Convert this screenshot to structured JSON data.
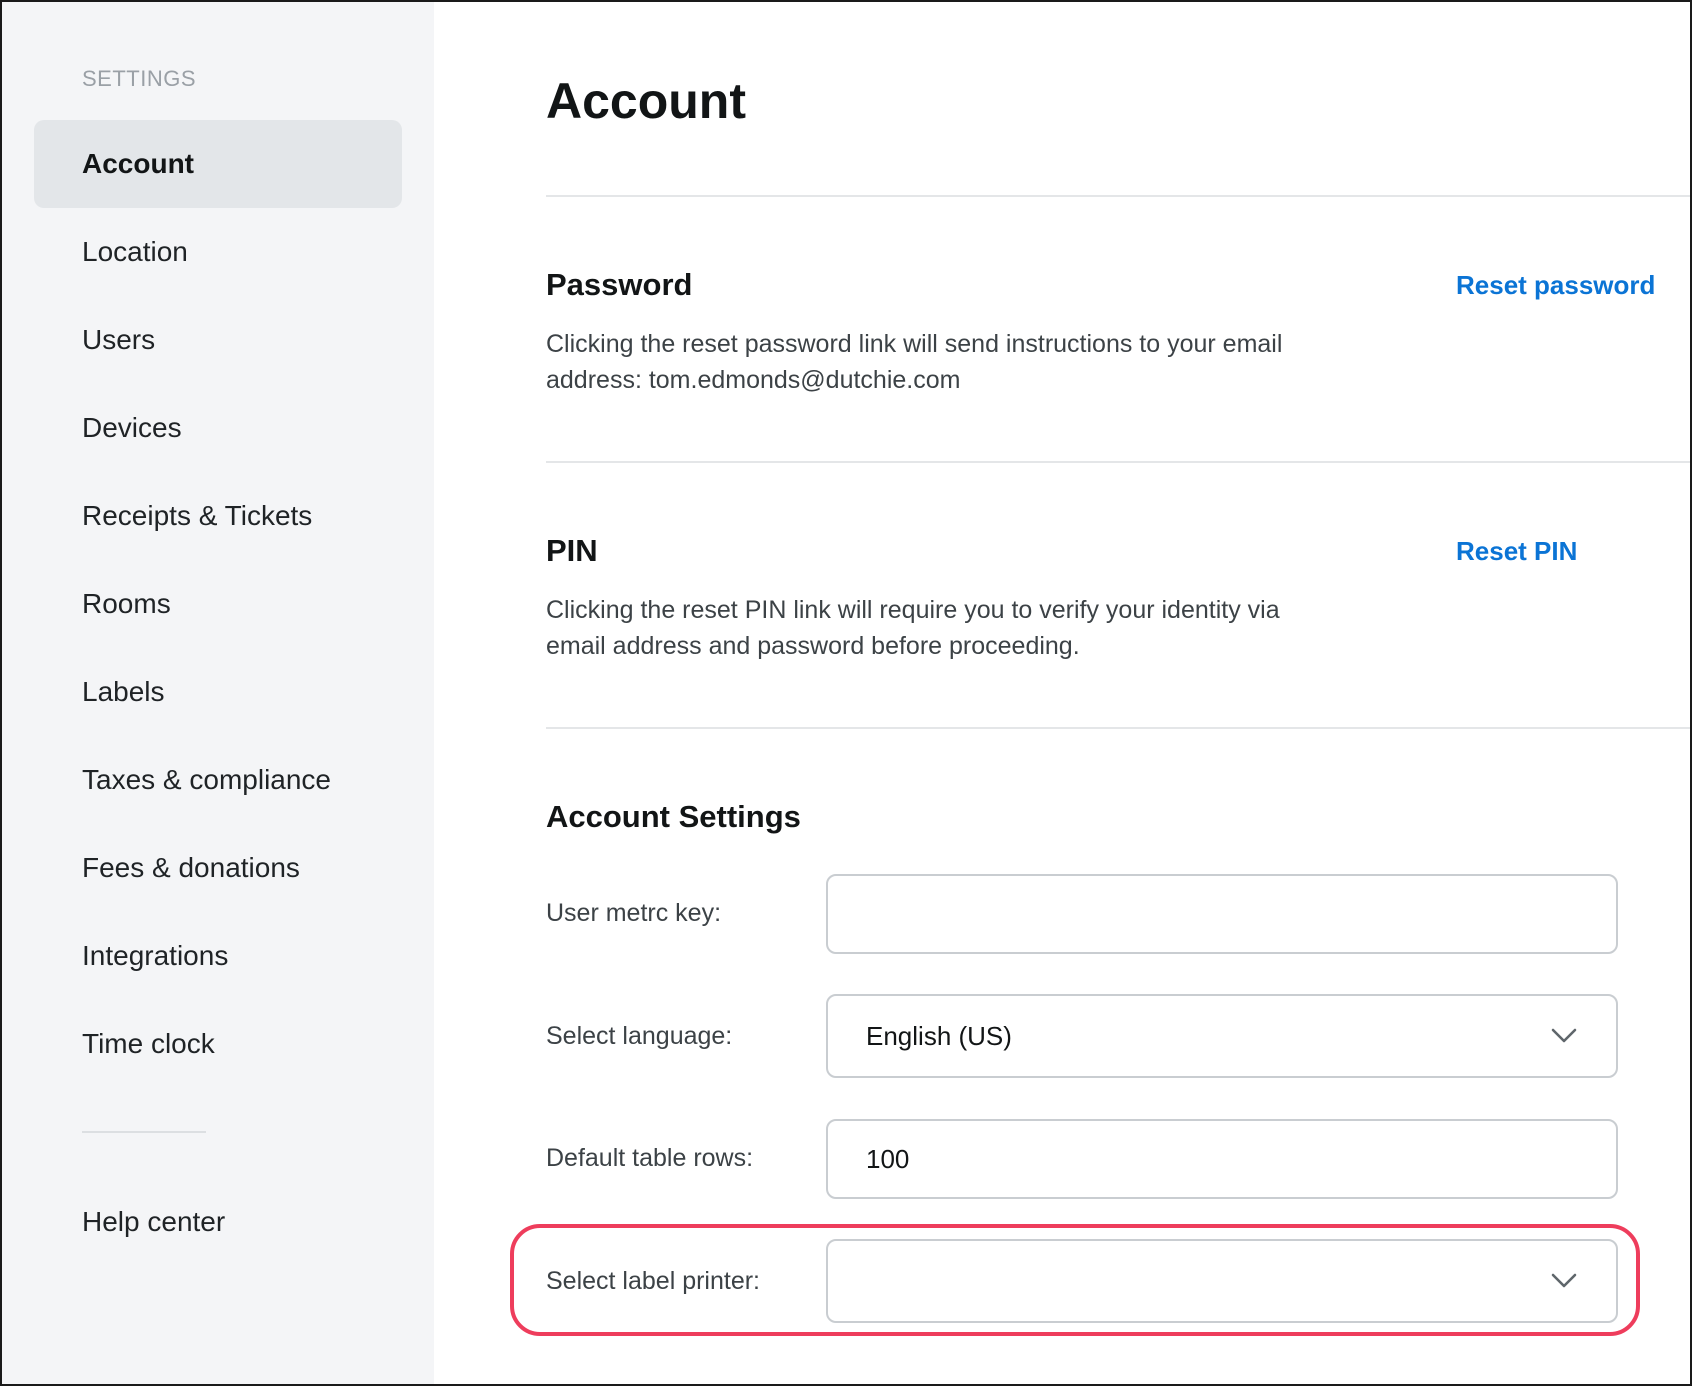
{
  "sidebar": {
    "heading": "SETTINGS",
    "items": [
      {
        "label": "Account",
        "active": true
      },
      {
        "label": "Location"
      },
      {
        "label": "Users"
      },
      {
        "label": "Devices"
      },
      {
        "label": "Receipts & Tickets"
      },
      {
        "label": "Rooms"
      },
      {
        "label": "Labels"
      },
      {
        "label": "Taxes & compliance"
      },
      {
        "label": "Fees & donations"
      },
      {
        "label": "Integrations"
      },
      {
        "label": "Time clock"
      }
    ],
    "help": {
      "label": "Help center"
    }
  },
  "main": {
    "title": "Account",
    "password": {
      "title": "Password",
      "description": "Clicking the reset password link will send instructions to your email address: tom.edmonds@dutchie.com",
      "link": "Reset password"
    },
    "pin": {
      "title": "PIN",
      "description": "Clicking the reset PIN link will require you to verify your identity via email address and password before proceeding.",
      "link": "Reset PIN"
    },
    "account_settings": {
      "title": "Account Settings",
      "metrc_key": {
        "label": "User metrc key:",
        "value": ""
      },
      "language": {
        "label": "Select language:",
        "value": "English (US)",
        "icon": "chevron-down-icon"
      },
      "table_rows": {
        "label": "Default table rows:",
        "value": "100"
      },
      "label_printer": {
        "label": "Select label printer:",
        "value": "",
        "icon": "chevron-down-icon"
      }
    }
  },
  "colors": {
    "accent_link": "#0b74d5",
    "highlight": "#ee3d5c",
    "sidebar_bg": "#f4f5f7",
    "active_bg": "#e3e6e9"
  }
}
